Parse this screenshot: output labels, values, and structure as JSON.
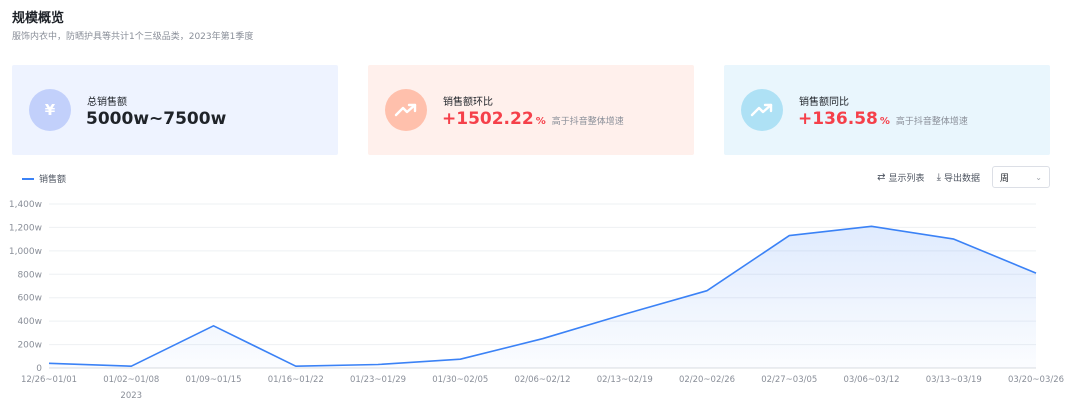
{
  "header": {
    "title": "规模概览",
    "subtitle": "服饰内衣中，防晒护具等共计1个三级品类，2023年第1季度"
  },
  "cards": [
    {
      "label": "总销售额",
      "value": "5000w~7500w",
      "icon": "yuan-icon",
      "glyph": "¥"
    },
    {
      "label": "销售额环比",
      "value": "+1502.22",
      "unit": "%",
      "note": "高于抖音整体增速",
      "icon": "trend-up-icon"
    },
    {
      "label": "销售额同比",
      "value": "+136.58",
      "unit": "%",
      "note": "高于抖音整体增速",
      "icon": "trend-up-icon"
    }
  ],
  "toolbar": {
    "show_list": "显示列表",
    "export": "导出数据",
    "period": "周"
  },
  "colors": {
    "line": "#3b82f6",
    "positive": "#f5404a"
  },
  "chart_data": {
    "type": "area",
    "series": [
      {
        "name": "销售额",
        "values": [
          40,
          15,
          360,
          15,
          30,
          75,
          250,
          460,
          660,
          1130,
          1210,
          1100,
          810
        ]
      }
    ],
    "categories": [
      "12/26~01/01",
      "01/02~01/08",
      "01/09~01/15",
      "01/16~01/22",
      "01/23~01/29",
      "01/30~02/05",
      "02/06~02/12",
      "02/13~02/19",
      "02/20~02/26",
      "02/27~03/05",
      "03/06~03/12",
      "03/13~03/19",
      "03/20~03/26"
    ],
    "year_label": "2023",
    "y_ticks": [
      "0",
      "200w",
      "400w",
      "600w",
      "800w",
      "1,000w",
      "1,200w",
      "1,400w"
    ],
    "ylim": [
      0,
      1400
    ],
    "unit": "w",
    "grid": true,
    "legend": "top-left"
  }
}
